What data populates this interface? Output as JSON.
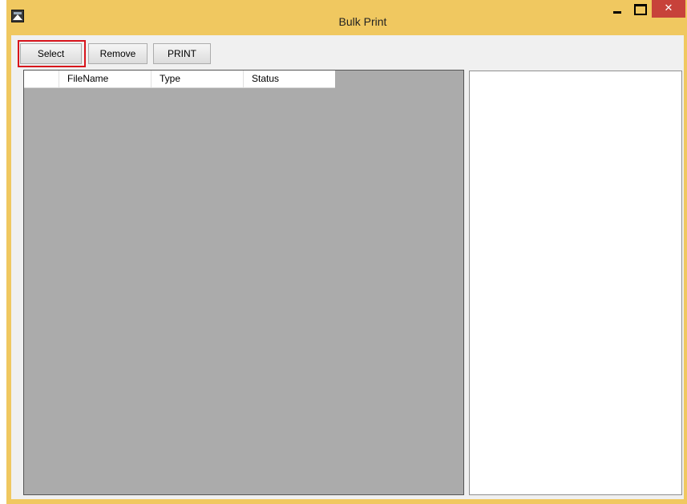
{
  "window": {
    "title": "Bulk Print",
    "controls": {
      "minimize_icon": "minimize-icon",
      "maximize_icon": "maximize-icon",
      "close_glyph": "✕"
    },
    "frame_color": "#f0c860",
    "close_color": "#c7423a"
  },
  "toolbar": {
    "select_label": "Select",
    "remove_label": "Remove",
    "print_label": "PRINT",
    "highlight_color": "#d7141c"
  },
  "grid": {
    "columns": [
      "",
      "FileName",
      "Type",
      "Status"
    ],
    "rows": [],
    "background": "#ababab"
  }
}
